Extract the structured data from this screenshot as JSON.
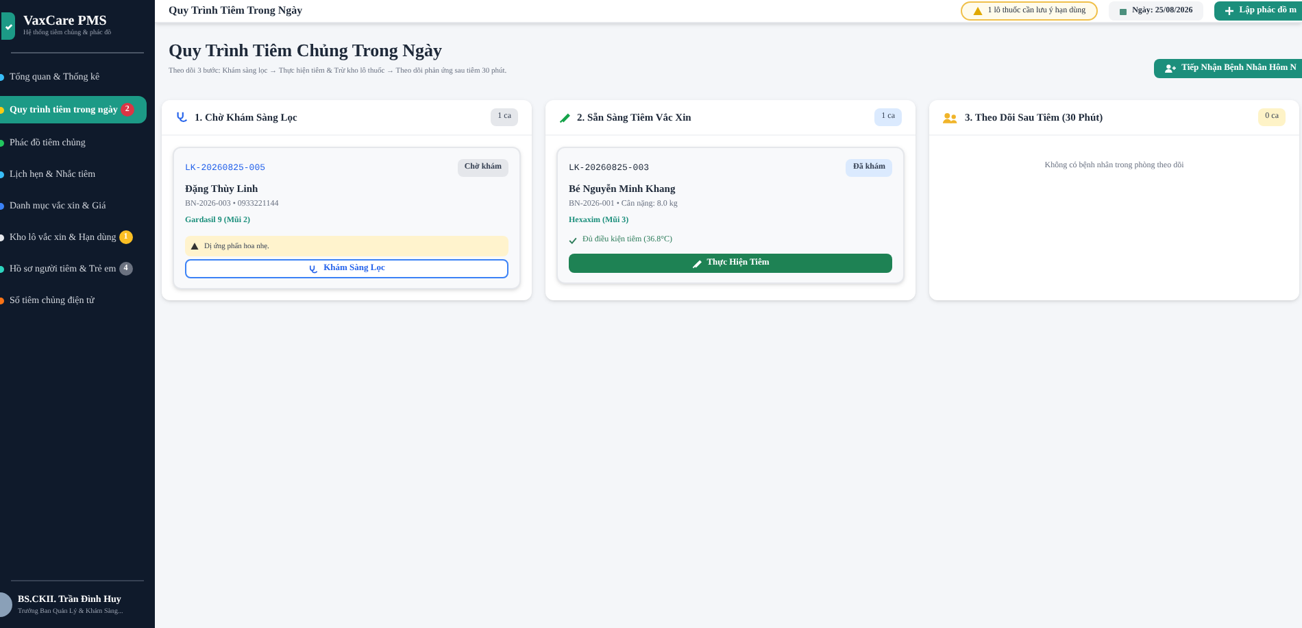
{
  "sidebar": {
    "brand": {
      "title": "VaxCare PMS",
      "subtitle": "Hệ thống tiêm chủng & phác đồ"
    },
    "items": [
      {
        "label": "Tổng quan & Thống kê",
        "selected": false
      },
      {
        "label": "Quy trình tiêm trong ngày",
        "selected": true,
        "badge": {
          "text": "2",
          "color": "#dc3545"
        }
      },
      {
        "label": "Phác đồ tiêm chủng",
        "selected": false
      },
      {
        "label": "Lịch hẹn & Nhắc tiêm",
        "selected": false
      },
      {
        "label": "Danh mục vắc xin & Giá",
        "selected": false
      },
      {
        "label": "Kho lô vắc xin & Hạn dùng",
        "selected": false,
        "badge": {
          "text": "1",
          "color": "#fbbf24"
        }
      },
      {
        "label": "Hồ sơ người tiêm & Trẻ em",
        "selected": false,
        "badge": {
          "text": "4",
          "color": "#6b7280"
        }
      },
      {
        "label": "Sổ tiêm chủng điện tử",
        "selected": false
      }
    ],
    "user": {
      "name": "BS.CKII. Trần Đình Huy",
      "role": "Trưởng Ban Quản Lý & Khám Sàng..."
    }
  },
  "header": {
    "title": "Quy Trình Tiêm Trong Ngày",
    "alert": "1 lô thuốc cần lưu ý hạn dùng",
    "date": "Ngày: 25/08/2026",
    "primary_button": "Lập phác đồ m"
  },
  "page": {
    "title": "Quy Trình Tiêm Chủng Trong Ngày",
    "subtitle": "Theo dõi 3 bước: Khám sàng lọc → Thực hiện tiêm & Trừ kho lô thuốc → Theo dõi phản ứng sau tiêm 30 phút.",
    "action_button": "Tiếp Nhận Bệnh Nhân Hôm N"
  },
  "columns": [
    {
      "title": "1. Chờ Khám Sàng Lọc",
      "count": {
        "text": "1 ca",
        "color": "#e5e7eb"
      },
      "cards": [
        {
          "code": "LK-20260825-005",
          "status": {
            "text": "Chờ khám",
            "color": "#e5e7eb"
          },
          "name": "Đặng Thùy Linh",
          "info": "BN-2026-003 • 0933221144",
          "vaccine": "Gardasil 9 (Mũi 2)",
          "note": {
            "kind": "warning",
            "text": "Dị ứng phấn hoa nhẹ."
          },
          "action": {
            "kind": "outline",
            "label": "Khám Sàng Lọc"
          }
        }
      ]
    },
    {
      "title": "2. Sẵn Sàng Tiêm Vắc Xin",
      "count": {
        "text": "1 ca",
        "color": "#dbeafe"
      },
      "cards": [
        {
          "code": "LK-20260825-003",
          "status": {
            "text": "Đã khám",
            "color": "#dbeafe"
          },
          "name": "Bé Nguyễn Minh Khang",
          "info": "BN-2026-001 • Cân nặng: 8.0 kg",
          "vaccine": "Hexaxim (Mũi 3)",
          "note": {
            "kind": "ok",
            "text": "Đủ điều kiện tiêm (36.8°C)"
          },
          "action": {
            "kind": "solid",
            "label": "Thực Hiện Tiêm"
          }
        }
      ]
    },
    {
      "title": "3. Theo Dõi Sau Tiêm (30 Phút)",
      "count": {
        "text": "0 ca",
        "color": "#fef3c7"
      },
      "empty": "Không có bệnh nhân trong phòng theo dõi"
    }
  ]
}
